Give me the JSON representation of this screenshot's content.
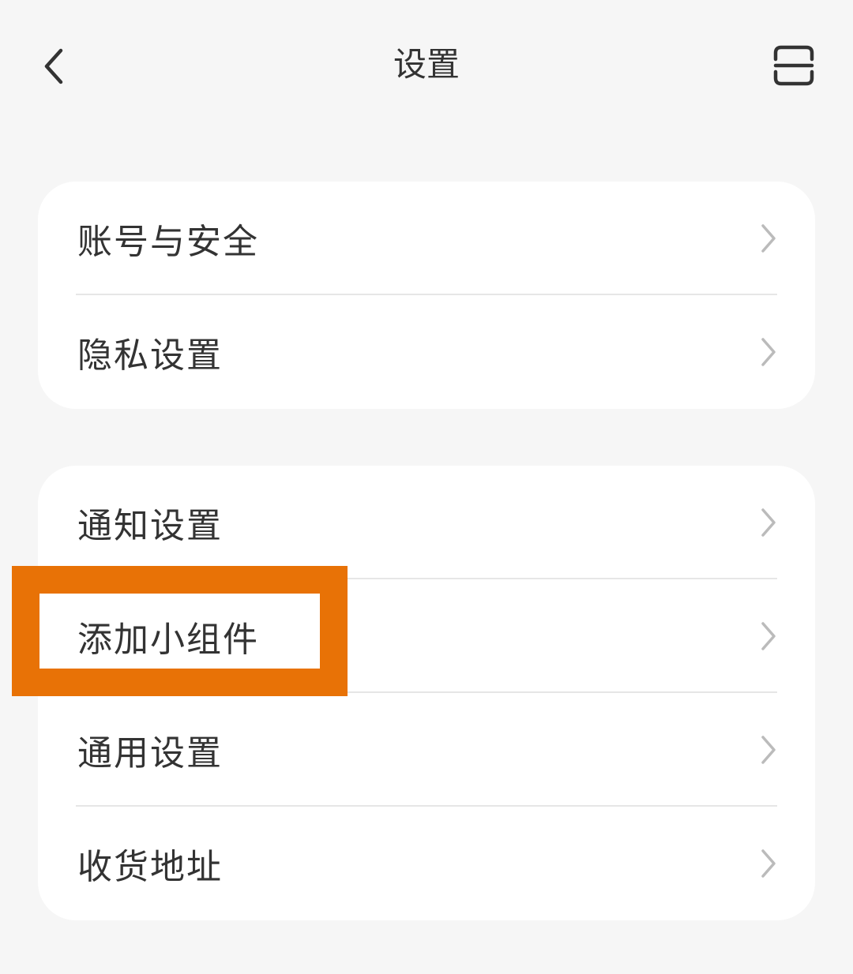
{
  "header": {
    "title": "设置",
    "back_icon": "chevron-left-icon",
    "scan_icon": "scan-icon"
  },
  "groups": [
    {
      "items": [
        {
          "label": "账号与安全"
        },
        {
          "label": "隐私设置"
        }
      ]
    },
    {
      "items": [
        {
          "label": "通知设置"
        },
        {
          "label": "添加小组件"
        },
        {
          "label": "通用设置"
        },
        {
          "label": "收货地址"
        }
      ]
    }
  ],
  "highlight": {
    "color": "#e87206",
    "target": "添加小组件"
  },
  "colors": {
    "background": "#f6f6f6",
    "card": "#ffffff",
    "text": "#333333",
    "chevron": "#bbbbbb"
  }
}
